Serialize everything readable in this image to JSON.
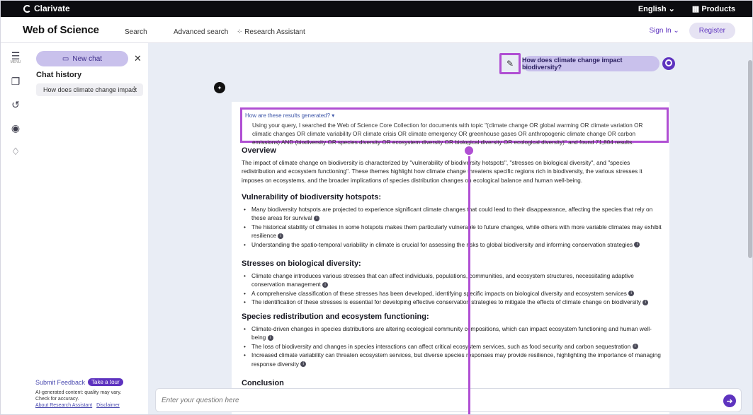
{
  "topbar": {
    "brand": "Clarivate",
    "language": "English",
    "products": "Products"
  },
  "header": {
    "logo": "Web of Science",
    "search": "Search",
    "advanced": "Advanced search",
    "assistant": "Research Assistant",
    "signin": "Sign In",
    "register": "Register"
  },
  "rail": {
    "menu_label": "MENU"
  },
  "sidebar": {
    "new_chat": "New chat",
    "chat_history": "Chat history",
    "history_items": [
      "How does climate change impact"
    ],
    "feedback": "Submit Feedback",
    "tour": "Take a tour",
    "disclaimer_line1": "AI-generated content: quality may vary.",
    "disclaimer_line2": "Check for accuracy.",
    "about_link": "About Research Assistant",
    "disclaimer_link": "Disclaimer"
  },
  "conversation": {
    "question": "How does climate change impact biodiversity?",
    "how_generated": "How are these results generated? ▾",
    "how_text": "Using your query, I searched the Web of Science Core Collection for documents with topic \"(climate change OR global warming OR climate variation OR climatic changes OR climate variability OR climate crisis OR climate emergency OR greenhouse gases OR anthropogenic climate change OR carbon emissions) AND (biodiversity OR species diversity OR ecosystem diversity OR biological diversity OR ecological diversity)\" and found 71,804 results.",
    "overview_title": "Overview",
    "overview_text": "The impact of climate change on biodiversity is characterized by \"vulnerability of biodiversity hotspots\", \"stresses on biological diversity\", and \"species redistribution and ecosystem functioning\". These themes highlight how climate change threatens specific regions rich in biodiversity, the various stresses it imposes on ecosystems, and the broader implications of species distribution changes on ecological balance and human well-being.",
    "sections": [
      {
        "title": "Vulnerability of biodiversity hotspots:",
        "items": [
          "Many biodiversity hotspots are projected to experience significant climate changes that could lead to their disappearance, affecting the species that rely on these areas for survival",
          "The historical stability of climates in some hotspots makes them particularly vulnerable to future changes, while others with more variable climates may exhibit resilience",
          "Understanding the spatio-temporal variability in climate is crucial for assessing the risks to global biodiversity and informing conservation strategies"
        ]
      },
      {
        "title": "Stresses on biological diversity:",
        "items": [
          "Climate change introduces various stresses that can affect individuals, populations, communities, and ecosystem structures, necessitating adaptive conservation management",
          "A comprehensive classification of these stresses has been developed, identifying specific impacts on biological diversity and ecosystem services",
          "The identification of these stresses is essential for developing effective conservation strategies to mitigate the effects of climate change on biodiversity"
        ]
      },
      {
        "title": "Species redistribution and ecosystem functioning:",
        "items": [
          "Climate-driven changes in species distributions are altering ecological community compositions, which can impact ecosystem functioning and human well-being",
          "The loss of biodiversity and changes in species interactions can affect critical ecosystem services, such as food security and carbon sequestration",
          "Increased climate variability can threaten ecosystem services, but diverse species responses may provide resilience, highlighting the importance of managing response diversity"
        ]
      }
    ],
    "conclusion_title": "Conclusion"
  },
  "input": {
    "placeholder": "Enter your question here"
  },
  "colors": {
    "accent": "#5e33bf",
    "highlight": "#b04fd3",
    "bubble": "#c9c1ec",
    "main_bg": "#e9edf5"
  },
  "icons": [
    "menu-icon",
    "notebook-icon",
    "history-icon",
    "profile-icon",
    "bell-icon",
    "chat-icon",
    "close-icon",
    "pencil-icon",
    "user-icon",
    "ai-icon",
    "send-icon",
    "info-icon"
  ]
}
